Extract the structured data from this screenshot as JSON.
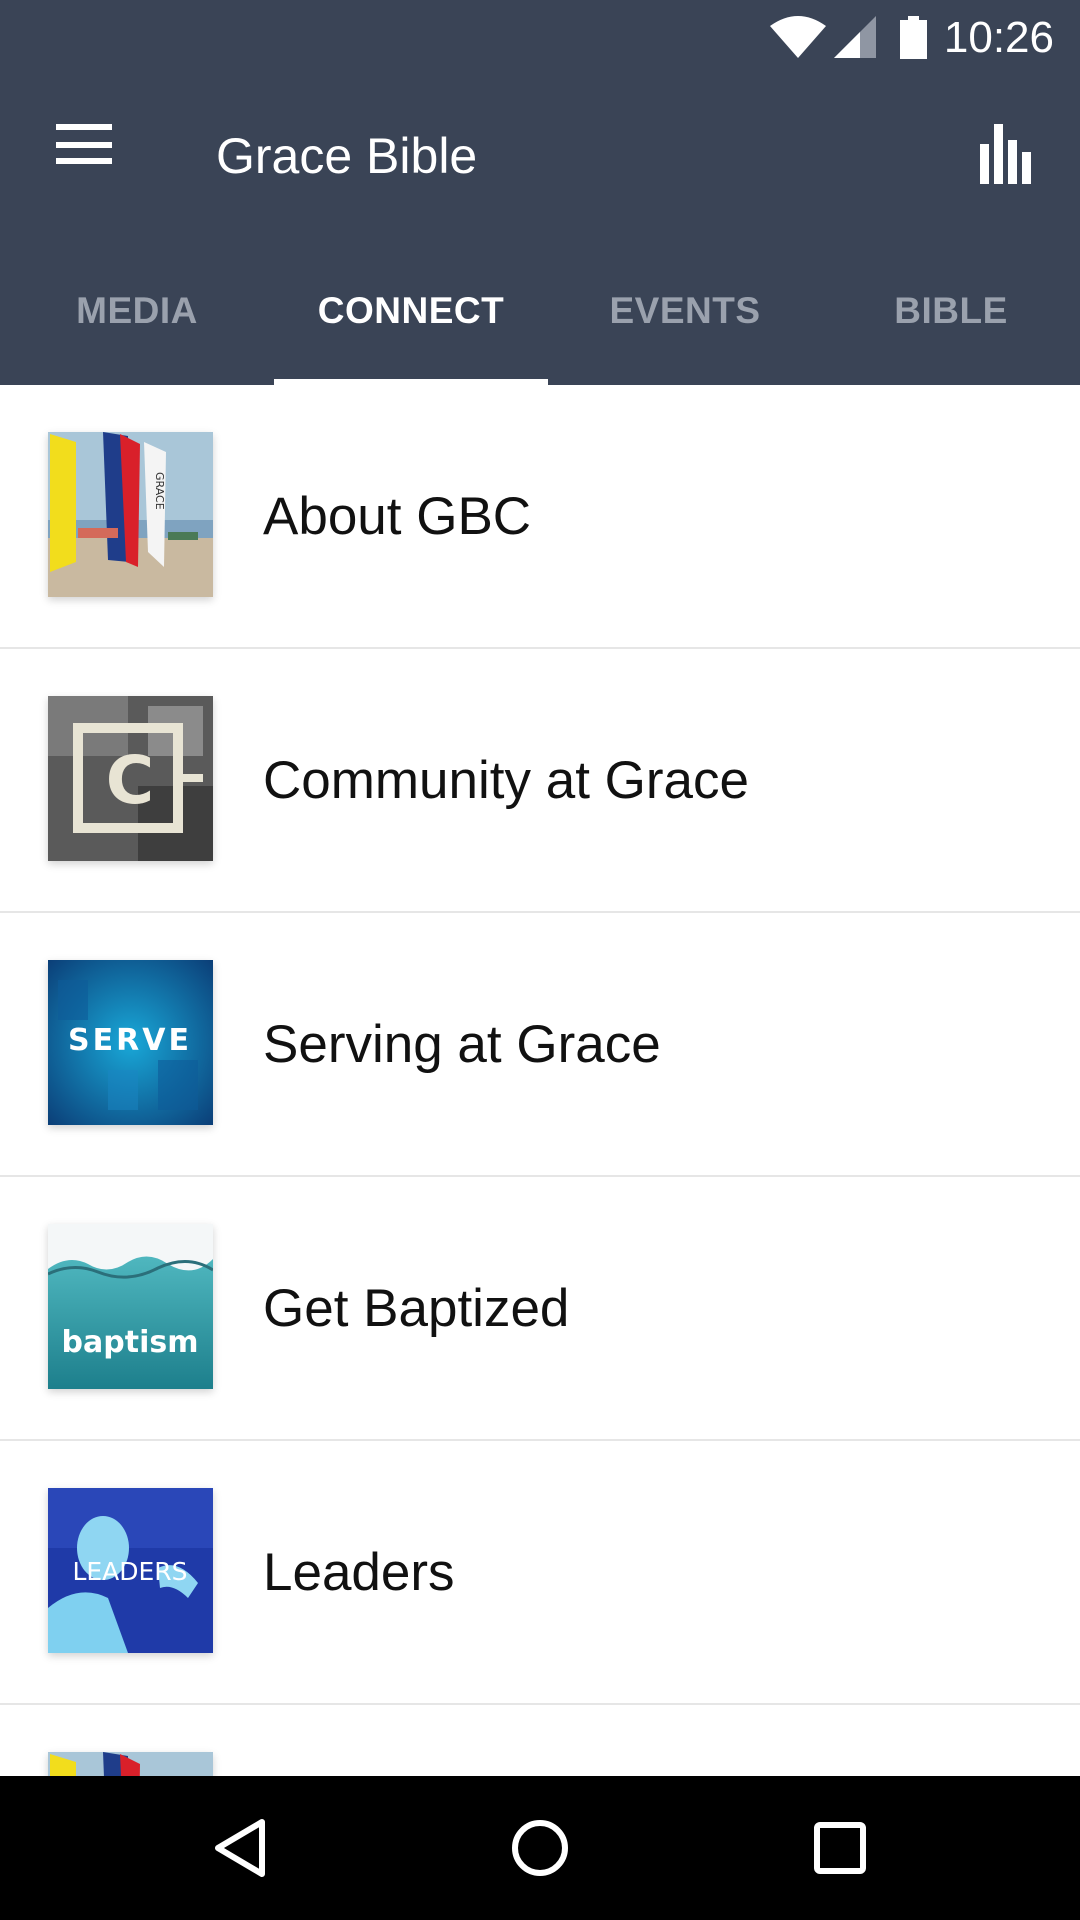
{
  "status_bar": {
    "time": "10:26",
    "icons": [
      "wifi-icon",
      "cell-signal-icon",
      "battery-icon"
    ]
  },
  "toolbar": {
    "title": "Grace Bible",
    "menu_icon": "hamburger-menu-icon",
    "action_icon": "bar-chart-icon"
  },
  "tabs": [
    {
      "label": "MEDIA",
      "active": false
    },
    {
      "label": "CONNECT",
      "active": true
    },
    {
      "label": "EVENTS",
      "active": false
    },
    {
      "label": "BIBLE",
      "active": false
    }
  ],
  "list": {
    "items": [
      {
        "label": "About GBC",
        "thumb_text": "GRACE"
      },
      {
        "label": "Community at Grace",
        "thumb_text": "C"
      },
      {
        "label": "Serving at Grace",
        "thumb_text": "SERVE"
      },
      {
        "label": "Get Baptized",
        "thumb_text": "baptism"
      },
      {
        "label": "Leaders",
        "thumb_text": "LEADERS"
      }
    ]
  },
  "nav_bar": {
    "icons": [
      "back-icon",
      "home-icon",
      "recent-apps-icon"
    ]
  },
  "colors": {
    "header_bg": "#3a4456",
    "tab_inactive": "#9aa1ad",
    "tab_active": "#ffffff",
    "divider": "#e6e6e6",
    "nav_bg": "#000000"
  }
}
